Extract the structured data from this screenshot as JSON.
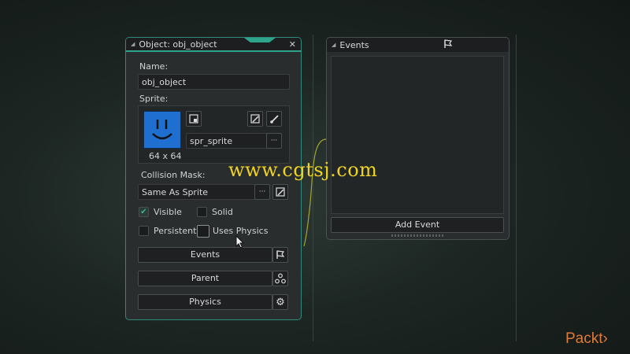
{
  "object_panel": {
    "title": "Object: obj_object",
    "name_label": "Name:",
    "name_value": "obj_object",
    "sprite_label": "Sprite:",
    "sprite_name": "spr_sprite",
    "sprite_size": "64 x 64",
    "collision_label": "Collision Mask:",
    "collision_value": "Same As Sprite",
    "ellipsis": "···",
    "checkboxes": {
      "visible": {
        "label": "Visible",
        "checked": true
      },
      "solid": {
        "label": "Solid",
        "checked": false
      },
      "persistent": {
        "label": "Persistent",
        "checked": false
      },
      "uses_physics": {
        "label": "Uses Physics",
        "checked": false
      }
    },
    "buttons": {
      "events": "Events",
      "parent": "Parent",
      "physics": "Physics"
    },
    "sprite_color": "#1f6fd0"
  },
  "events_panel": {
    "title": "Events",
    "add_event": "Add Event"
  },
  "watermark": "www.cgtsj.com",
  "brand": "Packt›",
  "accent_color": "#2fa48c",
  "icons": [
    "triangle-icon",
    "close-icon",
    "flag-icon",
    "new-sprite-icon",
    "edit-image-icon",
    "brush-icon",
    "ellipsis-icon",
    "parent-icon",
    "gear-icon",
    "check-icon",
    "mouse-cursor-icon"
  ]
}
